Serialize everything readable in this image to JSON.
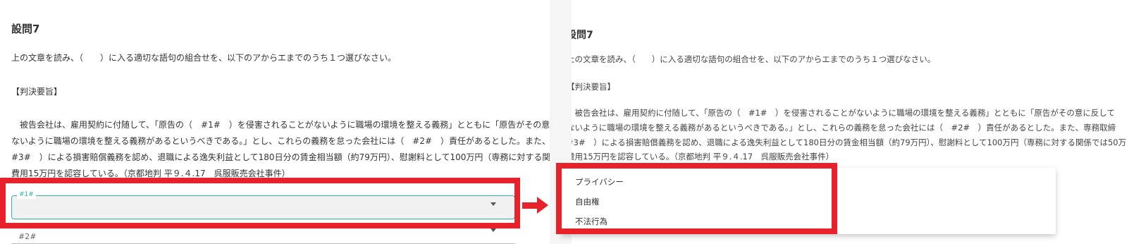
{
  "question": {
    "title": "設問7",
    "instruction": "上の文章を読み、（　　）に入る適切な語句の組合せを、以下のアからエまでのうち１つ選びなさい。",
    "section_header": "【判決要旨】",
    "body_lines_left": [
      "　被告会社は、雇用契約に付随して、「原告の（　#1#　）を侵害されることがないように職場の環境を整える義務」とともに「原告がその意に反して",
      "ないように職場の環境を整える義務があるというべきである。」とし、これらの義務を怠った会社には（　#2#　）責任があるとした。また、専務取締",
      "#3#　）による損害賠償義務を認め、退職による逸失利益として180日分の賃金相当額（約79万円）、慰謝料として100万円（専務に対する関係では50万",
      "費用15万円を認容している。（京都地判 平９.４.17　呉服販売会社事件）"
    ],
    "body_lines_right": [
      "　被告会社は、雇用契約に付随して、「原告の（　#1#　）を侵害されることがないように職場の環境を整える義務」とともに「原告がその意に反して",
      "ないように職場の環境を整える義務があるというべきである。」とし、これらの義務を怠った会社には（　#2#　）責任があるとした。また、専務取締",
      "#3#　）による損害賠償義務を認め、退職による逸失利益として180日分の賃金相当額（約79万円）、慰謝料として100万円（専務に対する関係では50万",
      "費用15万円を認容している。（京都地判 平９.４.17　呉服販売会社事件）"
    ]
  },
  "fields": {
    "field1_label": "#1#",
    "field1_value": "",
    "field2_label": "#2#"
  },
  "dropdown": {
    "options": [
      "プライバシー",
      "自由権",
      "不法行為"
    ]
  },
  "colors": {
    "highlight": "#e8222b",
    "accent": "#2bb3a7"
  }
}
